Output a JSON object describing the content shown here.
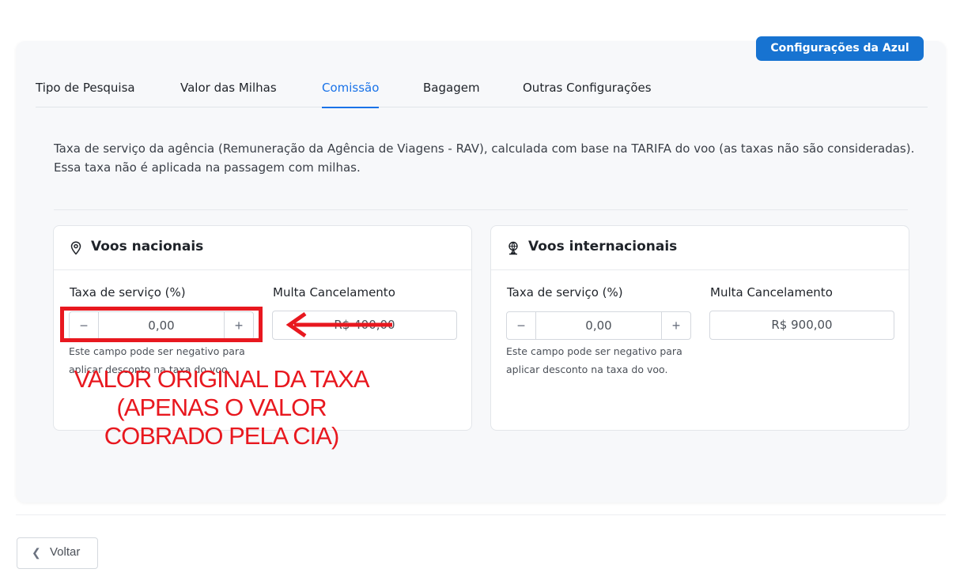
{
  "header": {
    "azul_button_label": "Configurações da Azul"
  },
  "tabs": [
    {
      "label": "Tipo de Pesquisa"
    },
    {
      "label": "Valor das Milhas"
    },
    {
      "label": "Comissão",
      "active": true
    },
    {
      "label": "Bagagem"
    },
    {
      "label": "Outras Configurações"
    }
  ],
  "description": {
    "line1": "Taxa de serviço da agência (Remuneração da Agência de Viagens - RAV), calculada com base na TARIFA do voo (as taxas não são consideradas).",
    "line2": "Essa taxa não é aplicada na passagem com milhas."
  },
  "national": {
    "title": "Voos nacionais",
    "icon": "map-pin-icon",
    "fee_label": "Taxa de serviço (%)",
    "fee_value": "0,00",
    "penalty_label": "Multa Cancelamento",
    "penalty_value": "R$ 400,00",
    "hint": "Este campo pode ser negativo para aplicar desconto na taxa do voo."
  },
  "international": {
    "title": "Voos internacionais",
    "icon": "globe-pin-icon",
    "fee_label": "Taxa de serviço (%)",
    "fee_value": "0,00",
    "penalty_label": "Multa Cancelamento",
    "penalty_value": "R$ 900,00",
    "hint": "Este campo pode ser negativo para aplicar desconto na taxa do voo."
  },
  "stepper": {
    "minus": "−",
    "plus": "+"
  },
  "footer": {
    "back_label": "Voltar"
  },
  "annotation": {
    "line1": "VALOR ORIGINAL DA TAXA",
    "line2": "(APENAS O VALOR",
    "line3": "COBRADO PELA CIA)",
    "color": "#e8181f"
  },
  "colors": {
    "accent": "#1a73e8",
    "button_blue": "#1773d1"
  }
}
